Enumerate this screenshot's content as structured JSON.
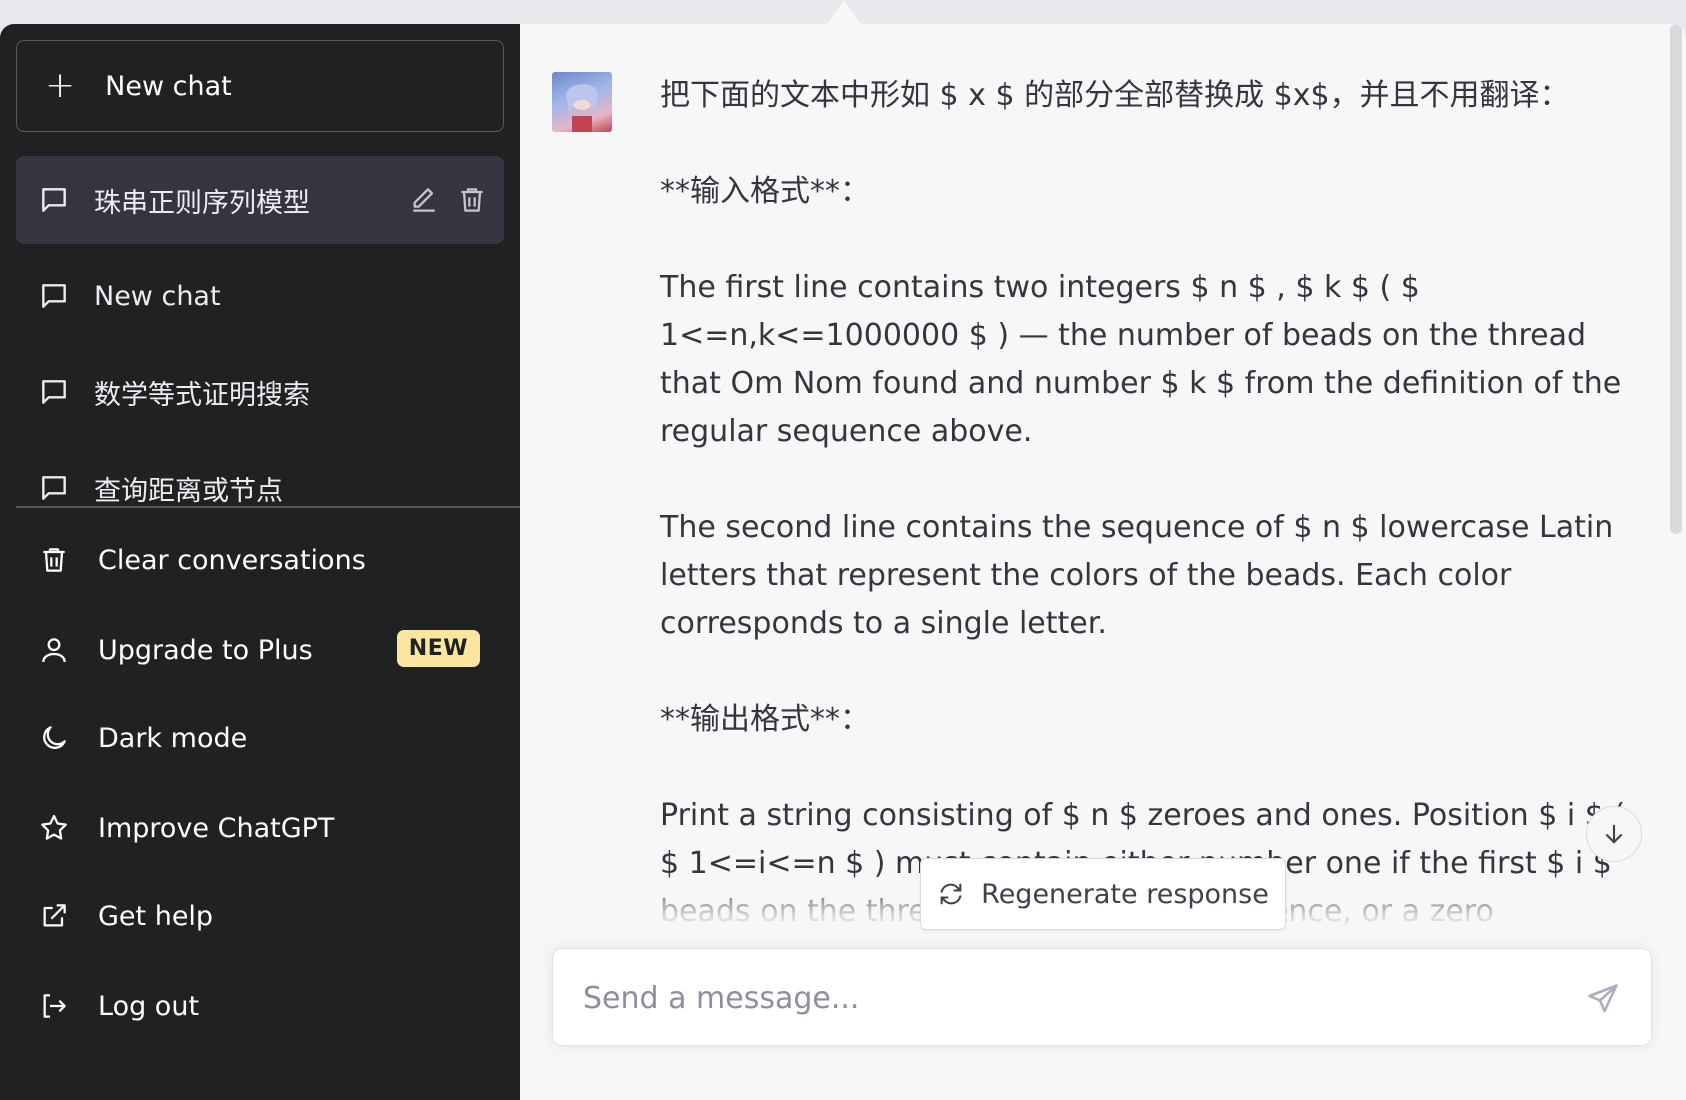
{
  "sidebar": {
    "new_chat_label": "New chat",
    "history": [
      {
        "label": "珠串正则序列模型",
        "active": true
      },
      {
        "label": "New chat",
        "active": false
      },
      {
        "label": "数学等式证明搜索",
        "active": false
      },
      {
        "label": "查询距离或节点",
        "active": false
      }
    ],
    "menu": {
      "clear": "Clear conversations",
      "upgrade": "Upgrade to Plus",
      "upgrade_badge": "NEW",
      "dark_mode": "Dark mode",
      "improve": "Improve ChatGPT",
      "help": "Get help",
      "logout": "Log out"
    }
  },
  "main": {
    "message": "把下面的文本中形如 $ x $ 的部分全部替换成 $x$，并且不用翻译：\n\n**输入格式**：\n\nThe first line contains two integers $ n $ , $ k $ ( $ 1<=n,k<=1000000 $ ) — the number of beads on the thread that Om Nom found and number $ k $ from the definition of the regular sequence above.\n\nThe second line contains the sequence of $ n $ lowercase Latin letters that represent the colors of the beads. Each color corresponds to a single letter.\n\n**输出格式**：\n\nPrint a string consisting of $ n $ zeroes and ones. Position $ i $ ( $ 1<=i<=n $ ) must contain either number one if the first $ i $ beads on the thread form a regular sequence, or a zero otherwise.",
    "regenerate_label": "Regenerate response",
    "input_placeholder": "Send a message..."
  },
  "colors": {
    "sidebar_bg": "#202123",
    "active_item_bg": "#343541",
    "badge_bg": "#fae69e",
    "main_bg": "#f7f7f8"
  }
}
